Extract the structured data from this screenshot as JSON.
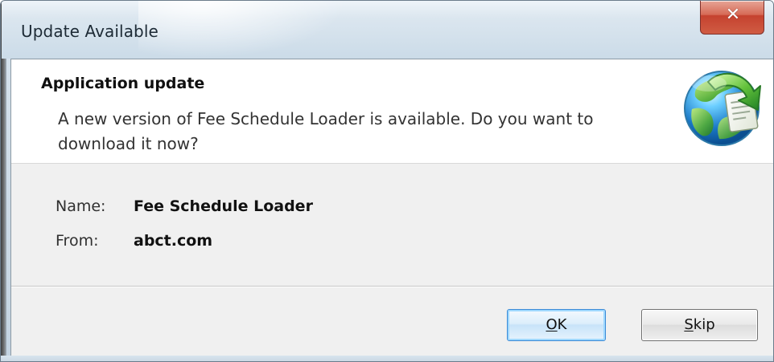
{
  "window": {
    "title": "Update Available"
  },
  "header": {
    "title": "Application update",
    "message": "A new version of Fee Schedule Loader is available. Do you want to download it now?",
    "icon": "update-globe-icon"
  },
  "details": {
    "name_label": "Name:",
    "name_value": "Fee Schedule Loader",
    "from_label": "From:",
    "from_value": "abct.com"
  },
  "buttons": {
    "ok_mnemonic": "O",
    "ok_rest": "K",
    "skip_mnemonic": "S",
    "skip_rest": "kip"
  },
  "colors": {
    "close_button": "#d05c43",
    "ok_focus_border": "#3b8ad6",
    "dialog_background": "#f0f0f0"
  }
}
